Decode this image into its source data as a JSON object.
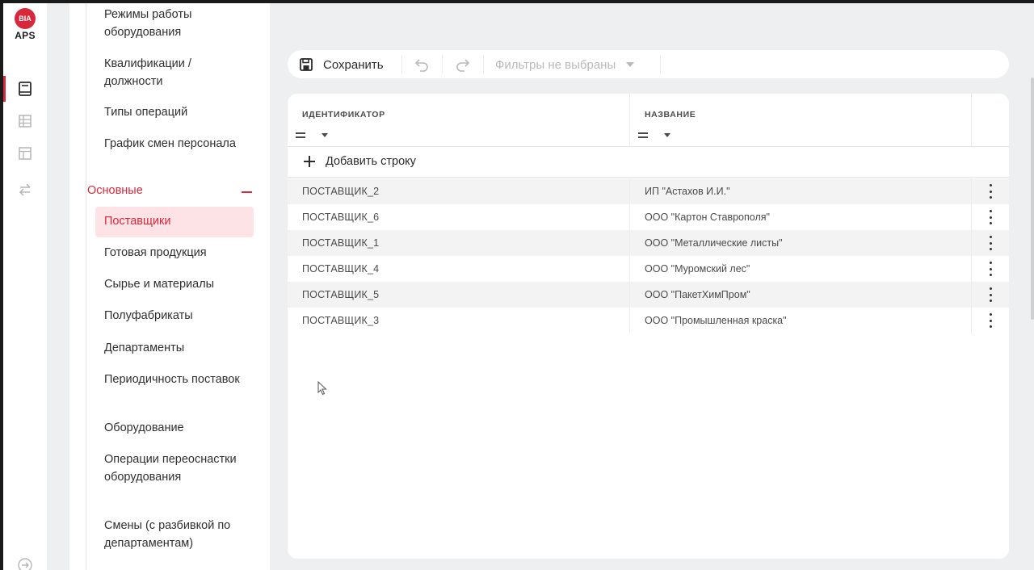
{
  "app": {
    "logo_badge": "BIA",
    "logo_text": "APS",
    "accent": "#d8283c"
  },
  "rail": {
    "items": [
      {
        "icon": "book-icon",
        "active": true
      },
      {
        "icon": "table-icon",
        "active": false
      },
      {
        "icon": "layout-icon",
        "active": false
      },
      {
        "icon": "transfer-icon",
        "active": false
      }
    ],
    "bottom_icon": "arrow-right-circle-icon"
  },
  "sidebar": {
    "items_top": [
      "Режимы работы оборудования",
      "Квалификации / должности",
      "Типы операций",
      "График смен персонала"
    ],
    "group": {
      "label": "Основные",
      "expanded": true
    },
    "items_group": [
      "Поставщики",
      "Готовая продукция",
      "Сырье и материалы",
      "Полуфабрикаты",
      "Департаменты",
      "Периодичность поставок",
      "Оборудование",
      "Операции переоснастки оборудования",
      "Смены (с разбивкой по департаментам)"
    ],
    "active_item": "Поставщики"
  },
  "toolbar": {
    "save_label": "Сохранить",
    "undo_icon": "undo-icon",
    "redo_icon": "redo-icon",
    "filter_placeholder": "Фильтры не выбраны"
  },
  "table": {
    "columns": [
      "ИДЕНТИФИКАТОР",
      "НАЗВАНИЕ"
    ],
    "add_row_label": "Добавить строку",
    "rows": [
      {
        "id": "ПОСТАВЩИК_2",
        "name": "ИП \"Астахов И.И.\""
      },
      {
        "id": "ПОСТАВЩИК_6",
        "name": "ООО \"Картон Ставрополя\""
      },
      {
        "id": "ПОСТАВЩИК_1",
        "name": "ООО \"Металлические листы\""
      },
      {
        "id": "ПОСТАВЩИК_4",
        "name": "ООО \"Муромский лес\""
      },
      {
        "id": "ПОСТАВЩИК_5",
        "name": "ООО \"ПакетХимПром\""
      },
      {
        "id": "ПОСТАВЩИК_3",
        "name": "ООО \"Промышленная краска\""
      }
    ]
  }
}
